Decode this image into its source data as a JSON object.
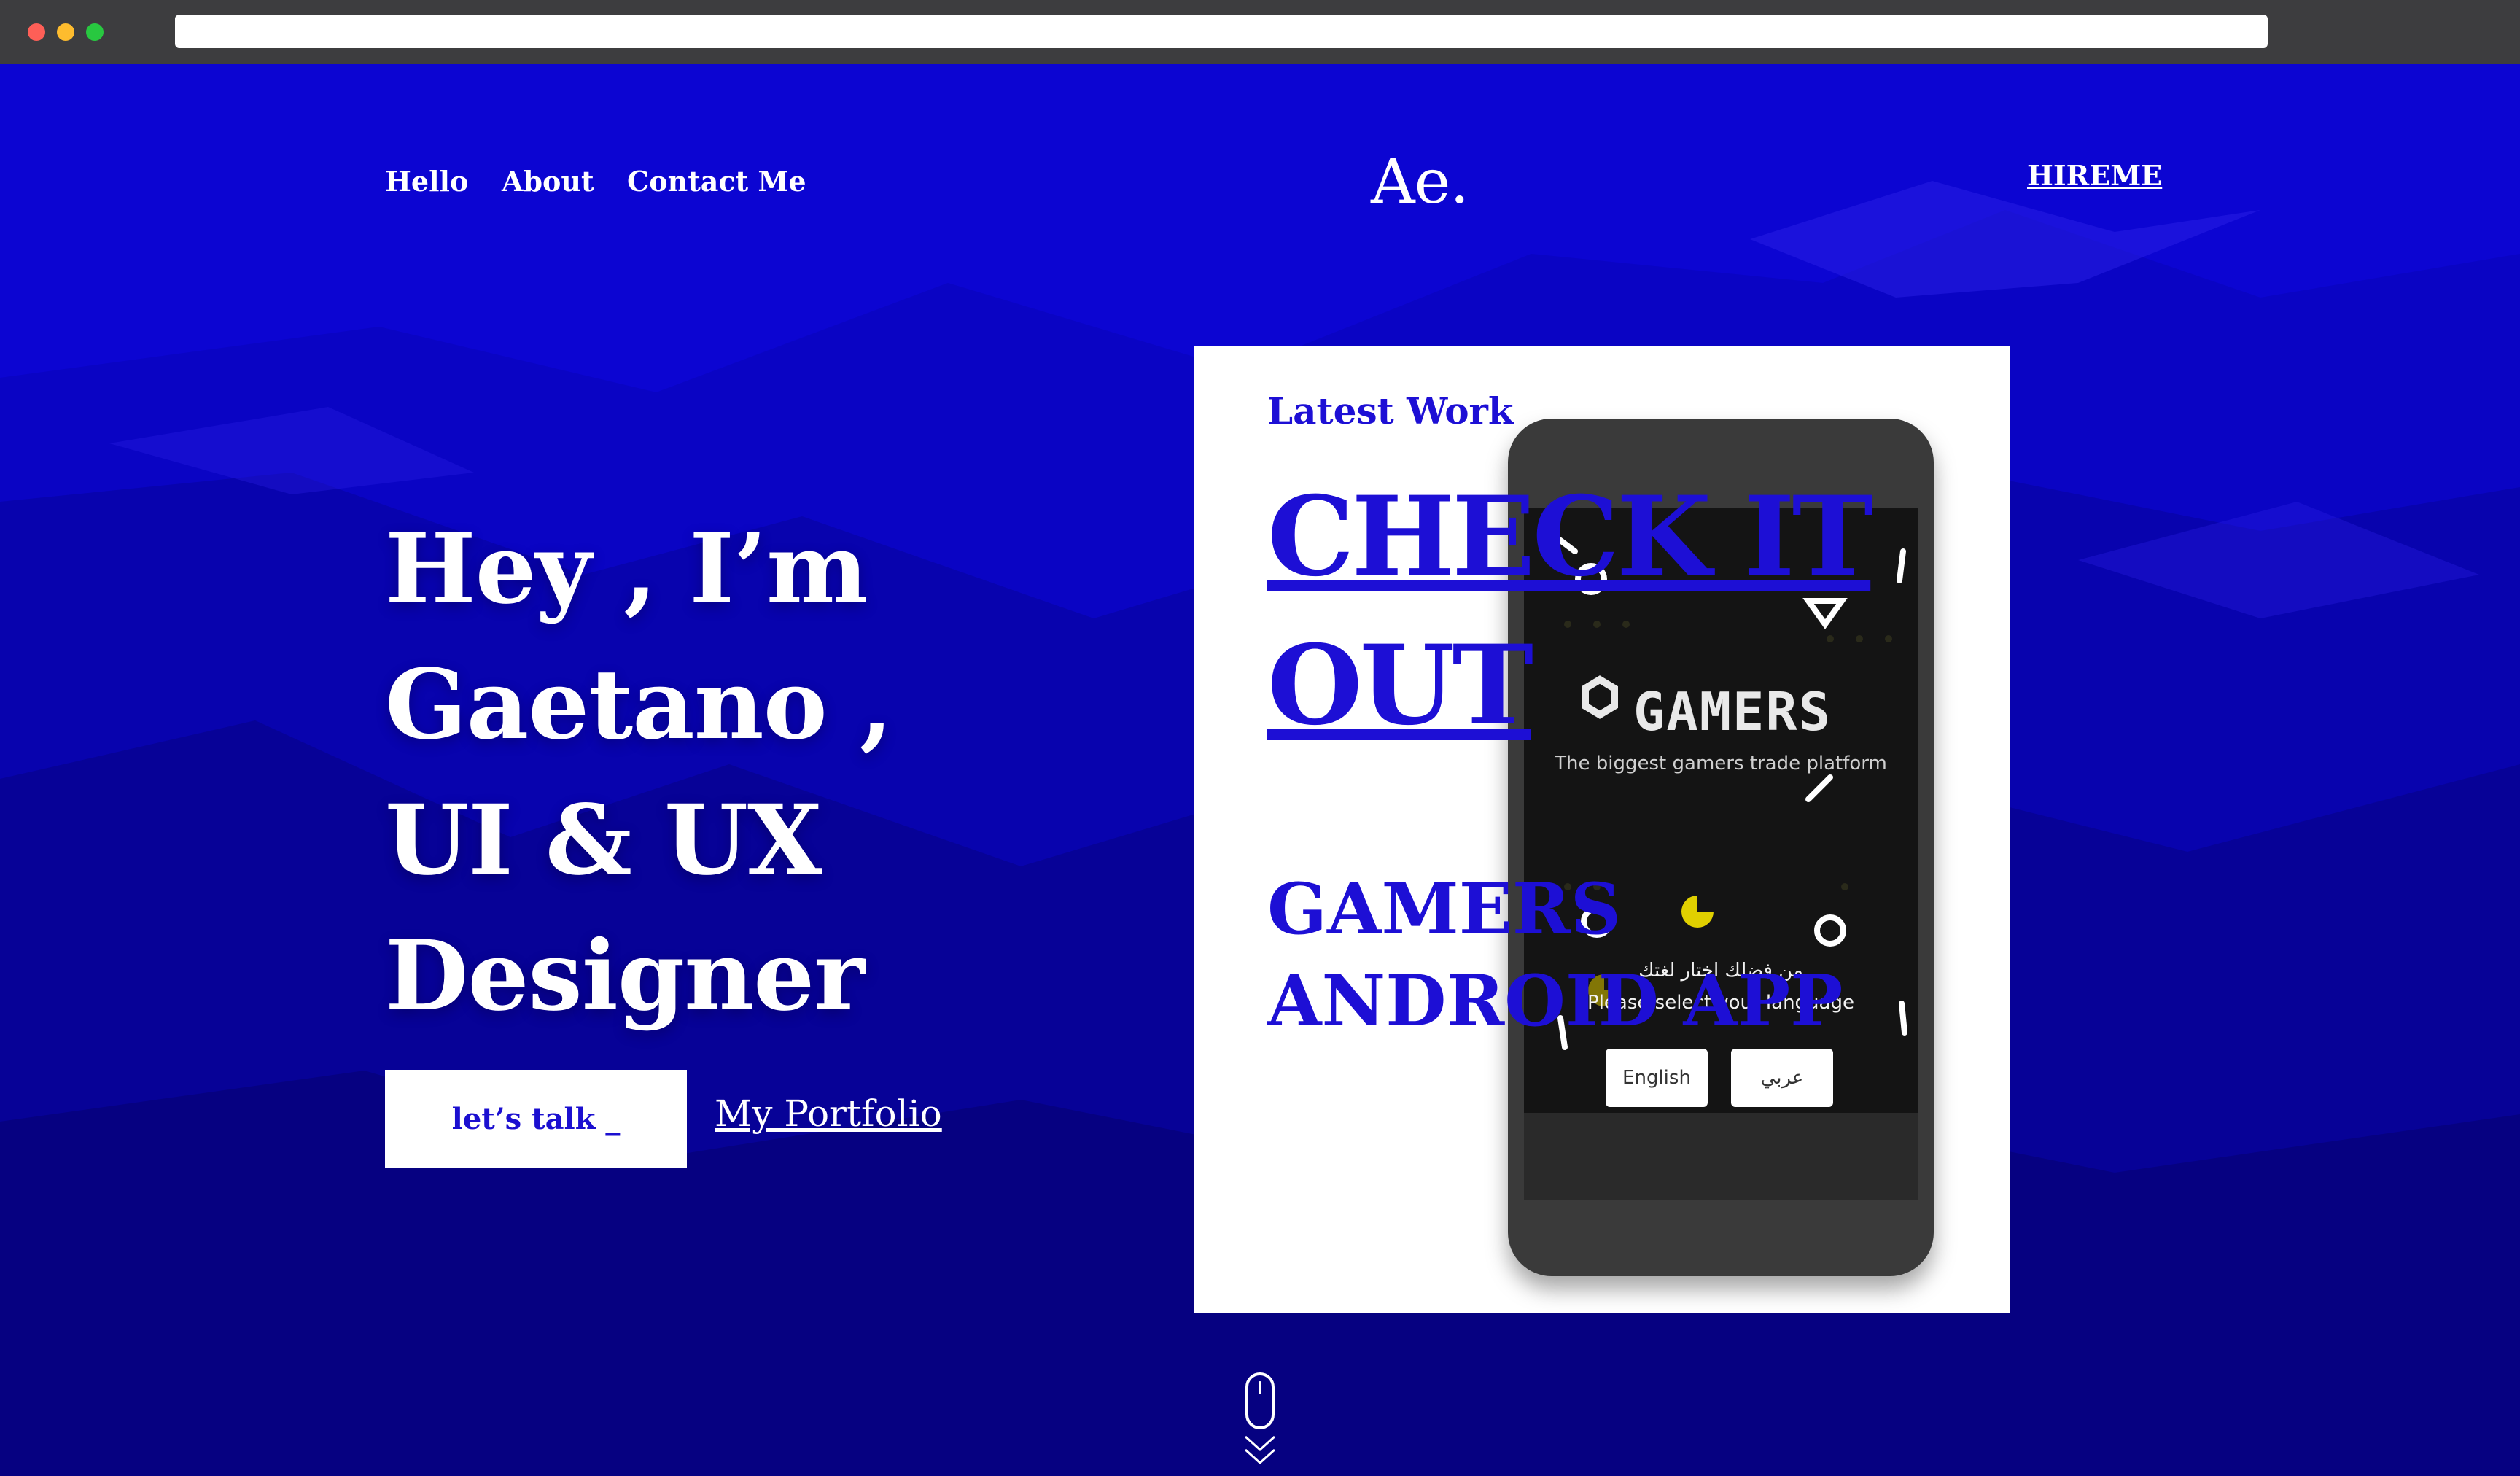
{
  "nav": {
    "links": [
      "Hello",
      "About",
      "Contact Me"
    ],
    "logo": "Ae.",
    "hireme": "HIREME"
  },
  "hero": {
    "heading": "Hey , I’m Gaetano , UI & UX Designer",
    "cta_button": "let’s talk _",
    "portfolio_link": "My Portfolio"
  },
  "latest_work": {
    "label": "Latest Work _",
    "cta": "CHECK IT OUT",
    "project_title": "GAMERS ANDROID APP"
  },
  "phone_app": {
    "name": "GAMERS",
    "tagline": "The biggest gamers trade platform",
    "arabic_prompt": "من فضلك اختار لغتك",
    "prompt": "Please select your language",
    "lang_buttons": [
      "English",
      "عربي"
    ]
  },
  "colors": {
    "brand_blue": "#0c05d2",
    "accent_blue": "#1d0fd5",
    "white": "#ffffff"
  },
  "icons": {
    "scroll": "mouse-scroll-icon"
  }
}
